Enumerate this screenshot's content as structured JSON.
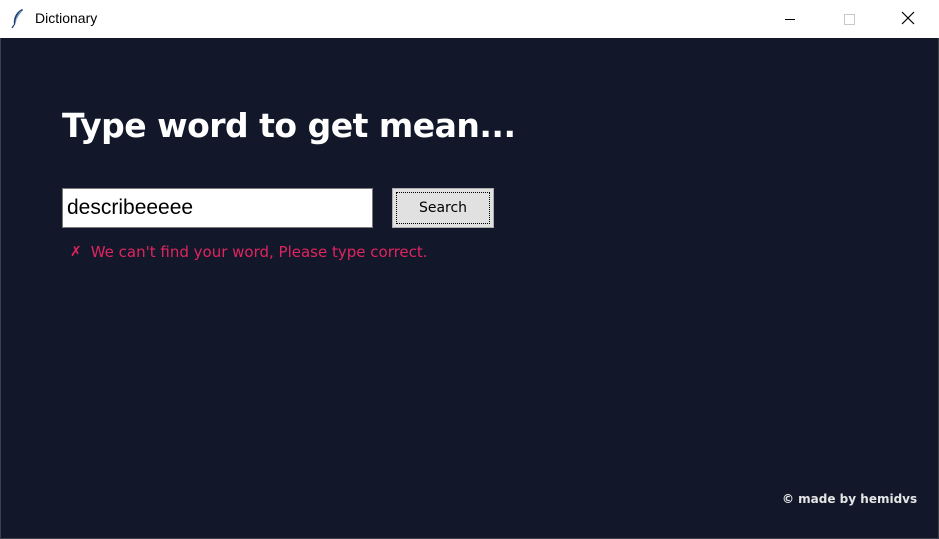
{
  "window": {
    "title": "Dictionary",
    "icon": "feather-icon",
    "controls": {
      "minimize": "minimize-icon",
      "maximize": "maximize-icon",
      "close": "close-icon"
    }
  },
  "main": {
    "heading": "Type word to get mean...",
    "search": {
      "value": "describeeeee",
      "button_label": "Search"
    },
    "error": {
      "icon_glyph": "✗",
      "message": "We can't find your word, Please type correct."
    },
    "footer": {
      "credit": "© made by hemidvs"
    }
  },
  "colors": {
    "background": "#12182a",
    "heading": "#ffffff",
    "error": "#e0245e",
    "button_bg": "#e1e1e1"
  }
}
